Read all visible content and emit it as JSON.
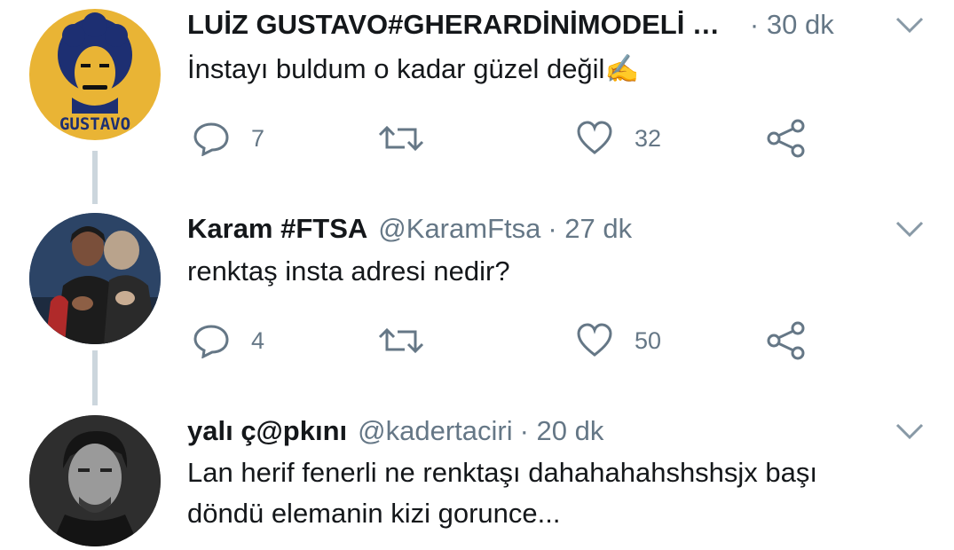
{
  "tweets": [
    {
      "avatar_text": "GUSTAVO",
      "name": "LUİZ GUSTAVO#GHERARDİNİMODELİ …",
      "handle": "",
      "time": "· 30 dk",
      "text_lines": [
        "İnstayı buldum o kadar güzel değil✍"
      ],
      "replies": "7",
      "retweets": "",
      "likes": "32"
    },
    {
      "name": "Karam #FTSA",
      "handle": "@KaramFtsa",
      "time": "· 27 dk",
      "text_lines": [
        "renktaş insta adresi nedir?"
      ],
      "replies": "4",
      "retweets": "",
      "likes": "50"
    },
    {
      "name": "yalı ç@pkını",
      "handle": "@kadertaciri",
      "time": "· 20 dk",
      "text_lines": [
        "Lan herif fenerli ne renktaşı dahahahahshshsjx başı",
        "döndü elemanin kizi gorunce..."
      ]
    }
  ],
  "colors": {
    "text": "#14171a",
    "secondary": "#657786",
    "thread_line": "#ccd6dd",
    "avatar_yellow": "#e9b435"
  }
}
